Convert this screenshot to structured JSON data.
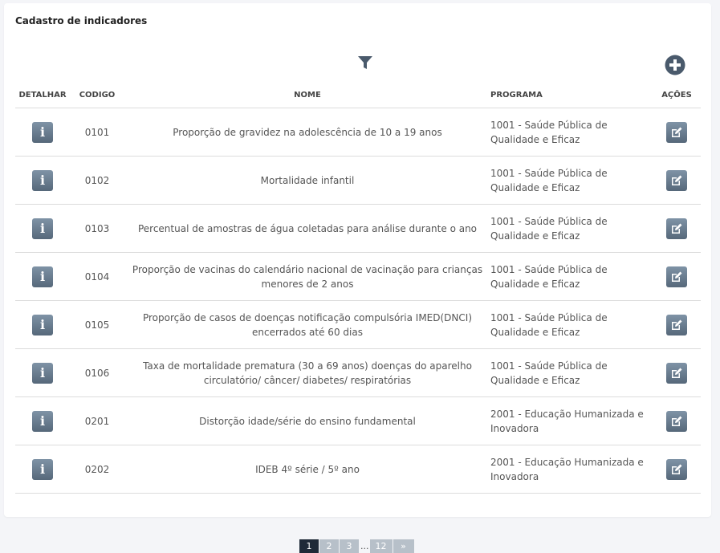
{
  "card": {
    "title": "Cadastro de indicadores"
  },
  "columns": {
    "detalhar": "DETALHAR",
    "codigo": "CODIGO",
    "nome": "NOME",
    "programa": "PROGRAMA",
    "acoes": "AÇÕES"
  },
  "info_glyph": "i",
  "rows": [
    {
      "codigo": "0101",
      "nome": "Proporção de gravidez na adolescência de 10 a 19 anos",
      "programa": "1001 - Saúde Pública de Qualidade e Eficaz"
    },
    {
      "codigo": "0102",
      "nome": "Mortalidade infantil",
      "programa": "1001 - Saúde Pública de Qualidade e Eficaz"
    },
    {
      "codigo": "0103",
      "nome": "Percentual de amostras de água coletadas para análise durante o ano",
      "programa": "1001 - Saúde Pública de Qualidade e Eficaz"
    },
    {
      "codigo": "0104",
      "nome": "Proporção de vacinas do calendário nacional de vacinação para crianças menores de 2 anos",
      "programa": "1001 - Saúde Pública de Qualidade e Eficaz"
    },
    {
      "codigo": "0105",
      "nome": "Proporção de casos de doenças notificação compulsória IMED(DNCI) encerrados até 60 dias",
      "programa": "1001 - Saúde Pública de Qualidade e Eficaz"
    },
    {
      "codigo": "0106",
      "nome": "Taxa de mortalidade prematura (30 a 69 anos) doenças do aparelho circulatório/ câncer/ diabetes/ respiratórias",
      "programa": "1001 - Saúde Pública de Qualidade e Eficaz"
    },
    {
      "codigo": "0201",
      "nome": "Distorção idade/série do ensino fundamental",
      "programa": "2001 - Educação Humanizada e Inovadora"
    },
    {
      "codigo": "0202",
      "nome": "IDEB 4º série / 5º ano",
      "programa": "2001 - Educação Humanizada e Inovadora"
    }
  ],
  "pagination": {
    "pages": [
      "1",
      "2",
      "3"
    ],
    "ellipsis": "...",
    "last": "12",
    "next": "»",
    "current": "1"
  },
  "colors": {
    "button": "#6b7f92",
    "icon": "#4a5a6c",
    "active_page": "#1f2a38",
    "inactive_page": "#b7c0c9"
  }
}
